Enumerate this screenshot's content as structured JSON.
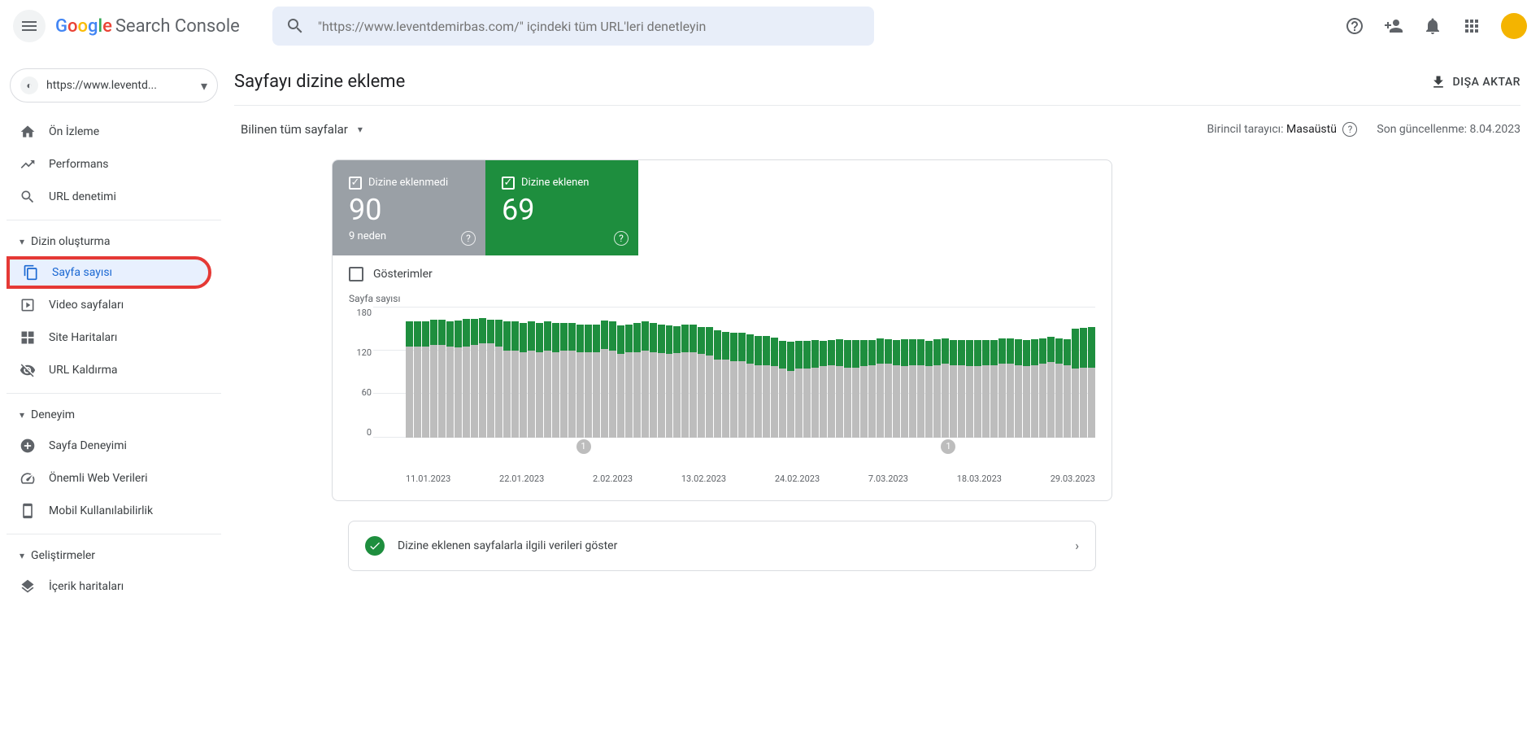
{
  "header": {
    "logo_text": "Search Console",
    "search_placeholder": "\"https://www.leventdemirbas.com/\" içindeki tüm URL'leri denetleyin"
  },
  "sidebar": {
    "property": "https://www.leventd...",
    "items": {
      "overview": "Ön İzleme",
      "performance": "Performans",
      "url_inspection": "URL denetimi"
    },
    "indexing": {
      "title": "Dizin oluşturma",
      "pages": "Sayfa sayısı",
      "video_pages": "Video sayfaları",
      "sitemaps": "Site Haritaları",
      "removals": "URL Kaldırma"
    },
    "experience": {
      "title": "Deneyim",
      "page_experience": "Sayfa Deneyimi",
      "core_web_vitals": "Önemli Web Verileri",
      "mobile_usability": "Mobil Kullanılabilirlik"
    },
    "enhancements": {
      "title": "Geliştirmeler",
      "sitelinks": "İçerik haritaları"
    }
  },
  "main": {
    "title": "Sayfayı dizine ekleme",
    "export": "DIŞA AKTAR",
    "filter": "Bilinen tüm sayfalar",
    "crawler_label": "Birincil tarayıcı:",
    "crawler_value": "Masaüstü",
    "updated_label": "Son güncellenme:",
    "updated_value": "8.04.2023"
  },
  "stats": {
    "not_indexed": {
      "label": "Dizine eklenmedi",
      "value": "90",
      "sub": "9 neden"
    },
    "indexed": {
      "label": "Dizine eklenen",
      "value": "69"
    }
  },
  "impressions_label": "Gösterimler",
  "chart_data": {
    "type": "bar",
    "title": "Sayfa sayısı",
    "ylabel": "Sayfa sayısı",
    "ylim": [
      0,
      180
    ],
    "yticks": [
      0,
      60,
      120,
      180
    ],
    "x_labels": [
      "11.01.2023",
      "22.01.2023",
      "2.02.2023",
      "13.02.2023",
      "24.02.2023",
      "7.03.2023",
      "18.03.2023",
      "29.03.2023"
    ],
    "series": [
      {
        "name": "Dizine eklenen",
        "color": "#1e8e3e"
      },
      {
        "name": "Dizine eklenmedi",
        "color": "#bdbdbd"
      }
    ],
    "values": [
      [
        125,
        35
      ],
      [
        125,
        35
      ],
      [
        125,
        35
      ],
      [
        128,
        35
      ],
      [
        128,
        35
      ],
      [
        125,
        35
      ],
      [
        124,
        38
      ],
      [
        126,
        38
      ],
      [
        128,
        36
      ],
      [
        130,
        35
      ],
      [
        130,
        33
      ],
      [
        125,
        38
      ],
      [
        120,
        40
      ],
      [
        120,
        40
      ],
      [
        118,
        40
      ],
      [
        120,
        40
      ],
      [
        118,
        40
      ],
      [
        120,
        40
      ],
      [
        118,
        40
      ],
      [
        120,
        38
      ],
      [
        120,
        38
      ],
      [
        118,
        38
      ],
      [
        118,
        38
      ],
      [
        118,
        38
      ],
      [
        122,
        40
      ],
      [
        120,
        40
      ],
      [
        115,
        40
      ],
      [
        118,
        38
      ],
      [
        118,
        40
      ],
      [
        120,
        40
      ],
      [
        118,
        40
      ],
      [
        116,
        40
      ],
      [
        115,
        40
      ],
      [
        116,
        38
      ],
      [
        118,
        38
      ],
      [
        118,
        38
      ],
      [
        115,
        38
      ],
      [
        113,
        40
      ],
      [
        108,
        40
      ],
      [
        108,
        38
      ],
      [
        105,
        40
      ],
      [
        105,
        40
      ],
      [
        102,
        40
      ],
      [
        100,
        40
      ],
      [
        100,
        40
      ],
      [
        98,
        40
      ],
      [
        95,
        38
      ],
      [
        92,
        40
      ],
      [
        95,
        38
      ],
      [
        95,
        38
      ],
      [
        96,
        38
      ],
      [
        98,
        35
      ],
      [
        100,
        35
      ],
      [
        98,
        38
      ],
      [
        96,
        38
      ],
      [
        96,
        38
      ],
      [
        98,
        36
      ],
      [
        100,
        35
      ],
      [
        102,
        35
      ],
      [
        102,
        34
      ],
      [
        100,
        34
      ],
      [
        98,
        38
      ],
      [
        100,
        36
      ],
      [
        100,
        36
      ],
      [
        98,
        35
      ],
      [
        100,
        36
      ],
      [
        102,
        35
      ],
      [
        100,
        35
      ],
      [
        100,
        34
      ],
      [
        98,
        36
      ],
      [
        98,
        36
      ],
      [
        100,
        35
      ],
      [
        100,
        35
      ],
      [
        102,
        35
      ],
      [
        102,
        35
      ],
      [
        100,
        36
      ],
      [
        98,
        36
      ],
      [
        100,
        36
      ],
      [
        102,
        35
      ],
      [
        104,
        35
      ],
      [
        102,
        35
      ],
      [
        100,
        36
      ],
      [
        95,
        55
      ],
      [
        96,
        55
      ],
      [
        96,
        56
      ]
    ],
    "annotations": [
      {
        "x_index": 21,
        "label": "1"
      },
      {
        "x_index": 66,
        "label": "1"
      }
    ]
  },
  "action": "Dizine eklenen sayfalarla ilgili verileri göster"
}
